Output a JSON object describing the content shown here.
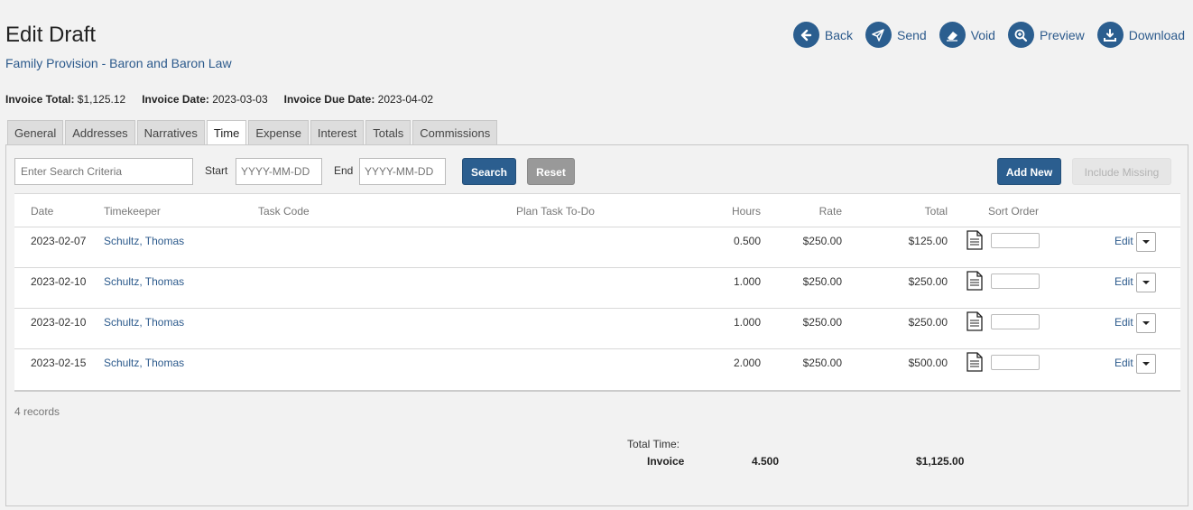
{
  "header": {
    "title": "Edit Draft",
    "subtitle": "Family Provision - Baron and Baron Law"
  },
  "actions": [
    {
      "label": "Back",
      "icon": "arrow-left-icon"
    },
    {
      "label": "Send",
      "icon": "paper-plane-icon"
    },
    {
      "label": "Void",
      "icon": "eraser-icon"
    },
    {
      "label": "Preview",
      "icon": "zoom-in-icon"
    },
    {
      "label": "Download",
      "icon": "download-icon"
    }
  ],
  "summary": {
    "invoice_total_label": "Invoice Total:",
    "invoice_total": "$1,125.12",
    "invoice_date_label": "Invoice Date:",
    "invoice_date": "2023-03-03",
    "due_date_label": "Invoice Due Date:",
    "due_date": "2023-04-02"
  },
  "tabs": [
    "General",
    "Addresses",
    "Narratives",
    "Time",
    "Expense",
    "Interest",
    "Totals",
    "Commissions"
  ],
  "active_tab": "Time",
  "filters": {
    "search_placeholder": "Enter Search Criteria",
    "start_label": "Start",
    "start_placeholder": "YYYY-MM-DD",
    "end_label": "End",
    "end_placeholder": "YYYY-MM-DD",
    "search_button": "Search",
    "reset_button": "Reset",
    "add_new_button": "Add New",
    "include_missing_button": "Include Missing"
  },
  "table": {
    "columns": {
      "date": "Date",
      "timekeeper": "Timekeeper",
      "task_code": "Task Code",
      "plan_task": "Plan Task To-Do",
      "hours": "Hours",
      "rate": "Rate",
      "total": "Total",
      "sort_order": "Sort Order"
    },
    "edit_label": "Edit",
    "rows": [
      {
        "date": "2023-02-07",
        "timekeeper": "Schultz, Thomas",
        "task_code": "",
        "plan_task": "",
        "hours": "0.500",
        "rate": "$250.00",
        "total": "$125.00",
        "sort_order": ""
      },
      {
        "date": "2023-02-10",
        "timekeeper": "Schultz, Thomas",
        "task_code": "",
        "plan_task": "",
        "hours": "1.000",
        "rate": "$250.00",
        "total": "$250.00",
        "sort_order": ""
      },
      {
        "date": "2023-02-10",
        "timekeeper": "Schultz, Thomas",
        "task_code": "",
        "plan_task": "",
        "hours": "1.000",
        "rate": "$250.00",
        "total": "$250.00",
        "sort_order": ""
      },
      {
        "date": "2023-02-15",
        "timekeeper": "Schultz, Thomas",
        "task_code": "",
        "plan_task": "",
        "hours": "2.000",
        "rate": "$250.00",
        "total": "$500.00",
        "sort_order": ""
      }
    ]
  },
  "footer": {
    "records": "4 records",
    "total_time_label": "Total Time:",
    "invoice_label": "Invoice",
    "invoice_hours": "4.500",
    "invoice_total": "$1,125.00"
  },
  "colors": {
    "accent": "#2b5e8f",
    "link": "#2c5a8c",
    "background": "#f2f2f2"
  }
}
